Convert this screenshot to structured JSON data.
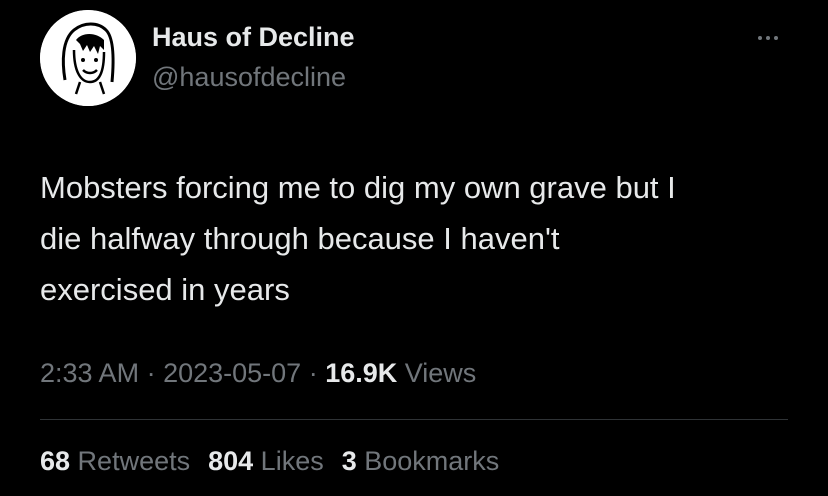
{
  "author": {
    "display_name": "Haus of Decline",
    "handle": "@hausofdecline",
    "avatar_icon": "cartoon-face-avatar-icon"
  },
  "more_icon": "more-horizontal-icon",
  "tweet": {
    "text_lines": [
      "Mobsters forcing me to dig my own grave but I",
      "die halfway through because I haven't",
      "exercised in years"
    ]
  },
  "meta": {
    "time": "2:33 AM",
    "separator": " · ",
    "date": "2023-05-07",
    "views_count": "16.9K",
    "views_label": " Views"
  },
  "stats": {
    "retweets_count": "68",
    "retweets_label": " Retweets",
    "likes_count": "804",
    "likes_label": " Likes",
    "bookmarks_count": "3",
    "bookmarks_label": " Bookmarks"
  },
  "colors": {
    "background": "#000000",
    "primary_text": "#e7e9ea",
    "secondary_text": "#71767b",
    "divider": "#2f3336"
  }
}
